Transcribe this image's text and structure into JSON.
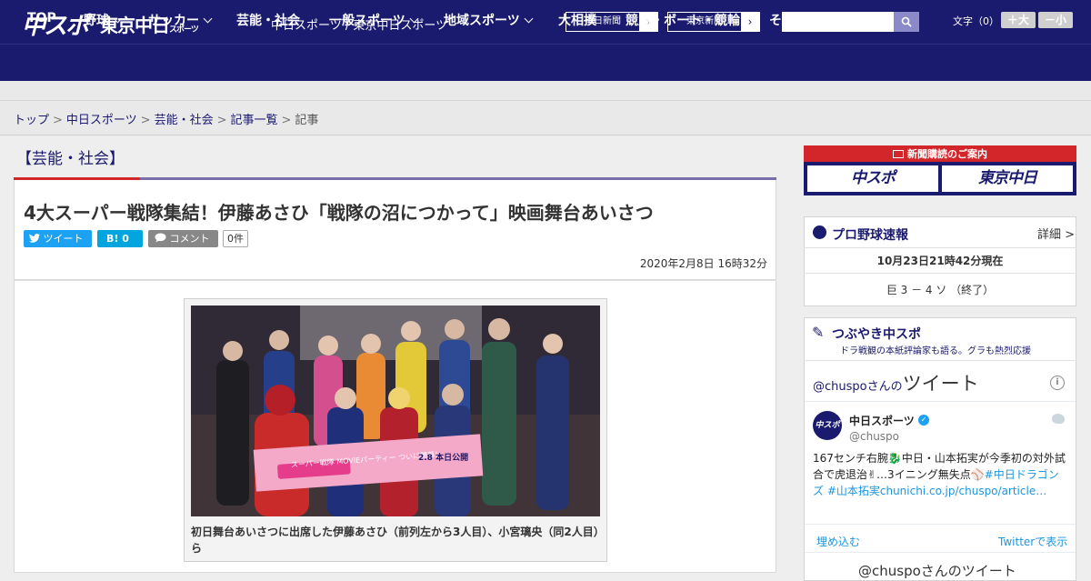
{
  "header": {
    "logo_chuspo": "中スポ",
    "logo_tokyo": "東京中日",
    "logo_tokyo_sub": "スポーツ",
    "site_link": "中日スポーツ / 東京中日スポーツ",
    "ext_links": [
      {
        "label": "中日新聞",
        "arrow": "›"
      },
      {
        "label": "東京新聞",
        "arrow": "›"
      }
    ],
    "search_placeholder": "",
    "search_icon": "search-icon",
    "fontsize_label": "文字（0）",
    "fontsize_larger": "＋大",
    "fontsize_smaller": "－小"
  },
  "nav": {
    "items": [
      {
        "label": "TOP"
      },
      {
        "label": "野球"
      },
      {
        "label": "サッカー"
      },
      {
        "label": "芸能・社会"
      },
      {
        "label": "一般スポーツ"
      },
      {
        "label": "地域スポーツ"
      },
      {
        "label": "大相撲"
      },
      {
        "label": "競馬・ボート・競輪"
      },
      {
        "label": "その他"
      }
    ]
  },
  "breadcrumb": {
    "items": [
      "トップ",
      "中日スポーツ",
      "芸能・社会",
      "記事一覧"
    ],
    "current": "記事",
    "separator": ">"
  },
  "article": {
    "section": "【芸能・社会】",
    "headline": "4大スーパー戦隊集結！伊藤あさひ「戦隊の沼につかって」映画舞台あいさつ",
    "share": {
      "tweet": "ツイート",
      "hatena": "B! 0",
      "comment": "コメント",
      "comment_count": "0件"
    },
    "date": "2020年2月8日 16時32分",
    "photo_banner_left": "スーパー戦隊 MOVIEパーティー ついに開幕！",
    "photo_banner_right": "2.8 本日公開",
    "caption": "初日舞台あいさつに出席した伊藤あさひ（前列左から3人目）、小宮璃央（同2人目）ら"
  },
  "sidebar": {
    "banner": {
      "title": "新聞購読のご案内",
      "logo_left": "中スポ",
      "logo_right": "東京中日"
    },
    "baseball": {
      "title": "プロ野球速報",
      "detail": "詳細 >",
      "time": "10月23日21時42分現在",
      "score": "巨 3 － 4 ソ （終了）"
    },
    "tweets": {
      "header_title": "つぶやき中スポ",
      "header_sub": "ドラ戦観の本紙評論家も語る。グラも熱烈応援",
      "title_prefix": "@chuspoさんの",
      "title_main": "ツイート",
      "info": "i",
      "avatar": "中スポ",
      "name": "中日スポーツ",
      "handle": "@chuspo",
      "text_plain": "167センチ右腕🐉中日・山本拓実が今季初の対外試合で虎退治✌…3イニング無失点⚾",
      "text_tags": "#中日ドラゴンズ #山本拓実chunichi.co.jp/chuspo/article…",
      "embed": "埋め込む",
      "view": "Twitterで表示",
      "more": "@chuspoさんのツイート"
    }
  },
  "colors": {
    "brand_navy": "#1a1a6e",
    "accent_red": "#d2262b",
    "twitter_blue": "#1da1f2"
  }
}
